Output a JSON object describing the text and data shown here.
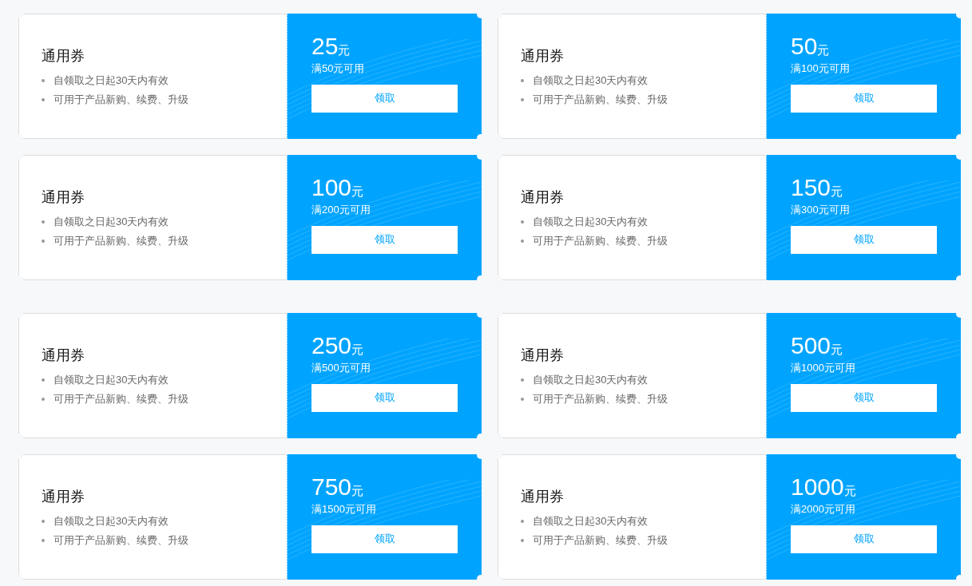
{
  "sections": [
    {
      "coupons": [
        {
          "title": "通用券",
          "terms": [
            "自领取之日起30天内有效",
            "可用于产品新购、续费、升级"
          ],
          "amount": "25",
          "unit": "元",
          "condition": "满50元可用",
          "button": "领取"
        },
        {
          "title": "通用券",
          "terms": [
            "自领取之日起30天内有效",
            "可用于产品新购、续费、升级"
          ],
          "amount": "50",
          "unit": "元",
          "condition": "满100元可用",
          "button": "领取"
        },
        {
          "title": "通用券",
          "terms": [
            "自领取之日起30天内有效",
            "可用于产品新购、续费、升级"
          ],
          "amount": "100",
          "unit": "元",
          "condition": "满200元可用",
          "button": "领取"
        },
        {
          "title": "通用券",
          "terms": [
            "自领取之日起30天内有效",
            "可用于产品新购、续费、升级"
          ],
          "amount": "150",
          "unit": "元",
          "condition": "满300元可用",
          "button": "领取"
        }
      ]
    },
    {
      "coupons": [
        {
          "title": "通用券",
          "terms": [
            "自领取之日起30天内有效",
            "可用于产品新购、续费、升级"
          ],
          "amount": "250",
          "unit": "元",
          "condition": "满500元可用",
          "button": "领取"
        },
        {
          "title": "通用券",
          "terms": [
            "自领取之日起30天内有效",
            "可用于产品新购、续费、升级"
          ],
          "amount": "500",
          "unit": "元",
          "condition": "满1000元可用",
          "button": "领取"
        },
        {
          "title": "通用券",
          "terms": [
            "自领取之日起30天内有效",
            "可用于产品新购、续费、升级"
          ],
          "amount": "750",
          "unit": "元",
          "condition": "满1500元可用",
          "button": "领取"
        },
        {
          "title": "通用券",
          "terms": [
            "自领取之日起30天内有效",
            "可用于产品新购、续费、升级"
          ],
          "amount": "1000",
          "unit": "元",
          "condition": "满2000元可用",
          "button": "领取"
        }
      ]
    }
  ]
}
